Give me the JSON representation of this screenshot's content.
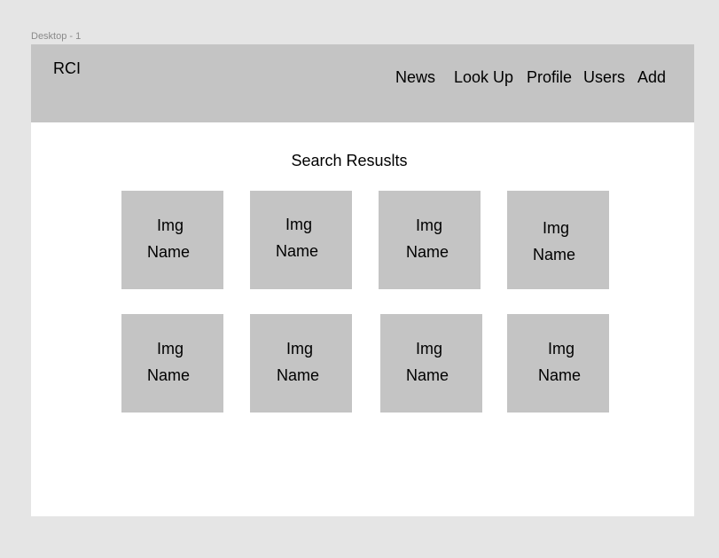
{
  "canvas": {
    "frame_label": "Desktop - 1"
  },
  "header": {
    "logo": "RCI",
    "nav": [
      {
        "label": "News"
      },
      {
        "label": "Look Up"
      },
      {
        "label": "Profile"
      },
      {
        "label": "Users"
      },
      {
        "label": "Add"
      }
    ]
  },
  "main": {
    "title": "Search Resuslts",
    "results": [
      {
        "img": "Img",
        "name": "Name"
      },
      {
        "img": "Img",
        "name": "Name"
      },
      {
        "img": "Img",
        "name": "Name"
      },
      {
        "img": "Img",
        "name": "Name"
      },
      {
        "img": "Img",
        "name": "Name"
      },
      {
        "img": "Img",
        "name": "Name"
      },
      {
        "img": "Img",
        "name": "Name"
      },
      {
        "img": "Img",
        "name": "Name"
      }
    ]
  },
  "colors": {
    "background": "#e5e5e5",
    "frame": "#ffffff",
    "header": "#c4c4c4",
    "card": "#c4c4c4",
    "text": "#000000"
  }
}
